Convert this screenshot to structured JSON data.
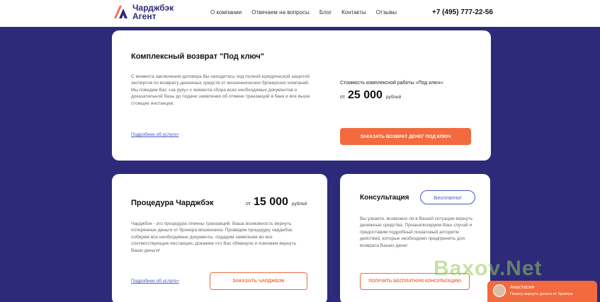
{
  "header": {
    "logo_line1": "Чарджбэк",
    "logo_line2": "Агент",
    "nav": [
      "О компании",
      "Отвечаем на вопросы",
      "Блог",
      "Контакты",
      "Отзывы"
    ],
    "phone": "+7 (495) 777-22-56"
  },
  "card_complex": {
    "title": "Комплексный возврат \"Под ключ\"",
    "description": "С момента заключения договора Вы находитесь под полной юридической защитой экспертов по возврату денежных средств от мошеннических брокерских компаний. Мы поведем Вас «за руку» с момента сбора всех необходимых документов и доказательной базы до подачи заявления об отмене транзакций в банк и все выше стоящие инстанции.",
    "link": "Подробнее об услуге»",
    "cost_label": "Стоимость комплексной работы «Под ключ»:",
    "price_from": "от",
    "price": "25 000",
    "price_unit": "рублей",
    "button": "ЗАКАЗАТЬ ВОЗВРАТ ДЕНЕГ ПОД КЛЮЧ"
  },
  "card_chargeback": {
    "title": "Процедура Чарджбэк",
    "price_from": "от",
    "price": "15 000",
    "price_unit": "рублей",
    "description": "Чарджбэк - это процедура отмены транзакций. Ваша возможность вернуть потерянные деньги от брокера мошенника. Проведем процедуру чарджбэк: соберем все необходимые документы, подадим заявление во все соответствующие инстанции, докажем что Вас обманули и поможем вернуть Ваши деньги!",
    "link": "Подробнее об услуге»",
    "button": "ЗАКАЗАТЬ ЧАРДЖБЭК"
  },
  "card_consult": {
    "title": "Консультация",
    "badge": "Бесплатно!",
    "description": "Вы узнаете, возможно ли в Вашей ситуации вернуть денежные средства. Проанализируем Ваш случай и предоставим подробный пошаговый алгоритм действий, которые необходимо предпринять для возврата Ваших денег",
    "button": "ПОЛУЧИТЬ БЕСПЛАТНУЮ КОНСУЛЬТАЦИЮ"
  },
  "watermark": "Baxov.Net",
  "chat": {
    "name": "Анастасия",
    "message": "Помогу вернуть деньги от брокера"
  },
  "colors": {
    "background": "#2d2a7a",
    "accent": "#f26a3d",
    "link": "#4a55c7"
  },
  "icons": {
    "logo": "logo-icon",
    "chat_avatar": "avatar"
  }
}
